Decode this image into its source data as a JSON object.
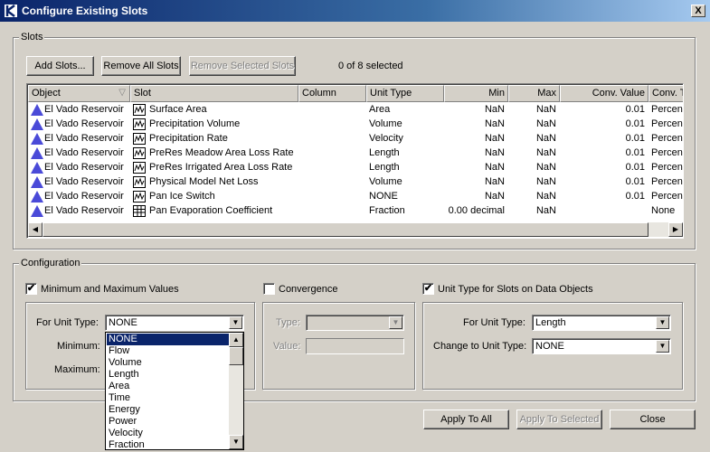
{
  "window": {
    "title": "Configure Existing Slots",
    "close_glyph": "X"
  },
  "slots_group": {
    "label": "Slots",
    "buttons": {
      "add": "Add Slots...",
      "remove_all": "Remove All Slots",
      "remove_selected": "Remove Selected Slots"
    },
    "selection_status": "0 of 8 selected",
    "columns": [
      "Object",
      "Slot",
      "Column",
      "Unit Type",
      "Min",
      "Max",
      "Conv. Value",
      "Conv. T"
    ],
    "rows": [
      {
        "object": "El Vado Reservoir",
        "slot": "Surface Area",
        "column": "",
        "unit_type": "Area",
        "min": "NaN",
        "max": "NaN",
        "conv_value": "0.01",
        "conv_type": "Percent",
        "slot_icon": "series-slot-icon"
      },
      {
        "object": "El Vado Reservoir",
        "slot": "Precipitation Volume",
        "column": "",
        "unit_type": "Volume",
        "min": "NaN",
        "max": "NaN",
        "conv_value": "0.01",
        "conv_type": "Percent",
        "slot_icon": "series-slot-icon"
      },
      {
        "object": "El Vado Reservoir",
        "slot": "Precipitation Rate",
        "column": "",
        "unit_type": "Velocity",
        "min": "NaN",
        "max": "NaN",
        "conv_value": "0.01",
        "conv_type": "Percent",
        "slot_icon": "series-slot-icon"
      },
      {
        "object": "El Vado Reservoir",
        "slot": "PreRes Meadow Area Loss Rate",
        "column": "",
        "unit_type": "Length",
        "min": "NaN",
        "max": "NaN",
        "conv_value": "0.01",
        "conv_type": "Percent",
        "slot_icon": "series-slot-icon"
      },
      {
        "object": "El Vado Reservoir",
        "slot": "PreRes Irrigated Area Loss Rate",
        "column": "",
        "unit_type": "Length",
        "min": "NaN",
        "max": "NaN",
        "conv_value": "0.01",
        "conv_type": "Percent",
        "slot_icon": "series-slot-icon"
      },
      {
        "object": "El Vado Reservoir",
        "slot": "Physical Model Net Loss",
        "column": "",
        "unit_type": "Volume",
        "min": "NaN",
        "max": "NaN",
        "conv_value": "0.01",
        "conv_type": "Percent",
        "slot_icon": "series-slot-icon"
      },
      {
        "object": "El Vado Reservoir",
        "slot": "Pan Ice Switch",
        "column": "",
        "unit_type": "NONE",
        "min": "NaN",
        "max": "NaN",
        "conv_value": "0.01",
        "conv_type": "Percent",
        "slot_icon": "series-slot-icon"
      },
      {
        "object": "El Vado Reservoir",
        "slot": "Pan Evaporation Coefficient",
        "column": "",
        "unit_type": "Fraction",
        "min": "0.00 decimal",
        "max": "NaN",
        "conv_value": "",
        "conv_type": "None",
        "slot_icon": "table-slot-icon"
      }
    ]
  },
  "config_group": {
    "label": "Configuration",
    "minmax": {
      "checkbox_label": "Minimum and Maximum Values",
      "checked": true,
      "unit_type_label": "For Unit Type:",
      "unit_type_value": "NONE",
      "minimum_label": "Minimum:",
      "maximum_label": "Maximum:"
    },
    "convergence": {
      "checkbox_label": "Convergence",
      "checked": false,
      "type_label": "Type:",
      "value_label": "Value:"
    },
    "unit_type": {
      "checkbox_label": "Unit Type for Slots on Data Objects",
      "checked": true,
      "for_unit_label": "For Unit Type:",
      "for_unit_value": "Length",
      "change_to_label": "Change to Unit Type:",
      "change_to_value": "NONE"
    },
    "dropdown_options": [
      "NONE",
      "Flow",
      "Volume",
      "Length",
      "Area",
      "Time",
      "Energy",
      "Power",
      "Velocity",
      "Fraction"
    ],
    "dropdown_selected": "NONE"
  },
  "footer": {
    "apply_all": "Apply To All",
    "apply_selected": "Apply To Selected",
    "close": "Close"
  },
  "check_glyph": "✔"
}
